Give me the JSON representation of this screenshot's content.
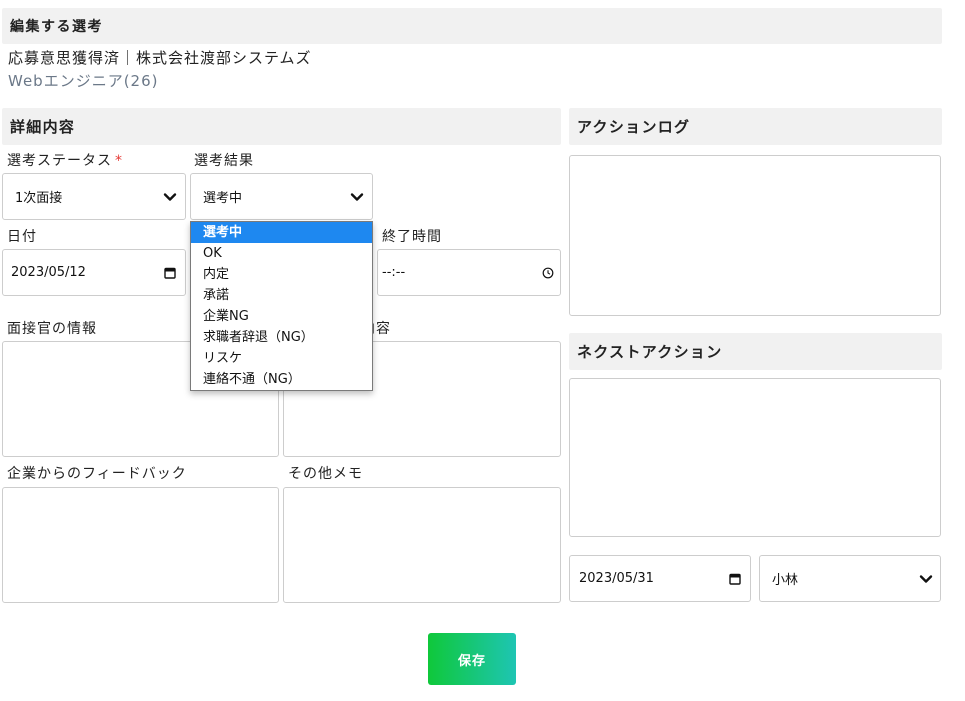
{
  "page": {
    "title": "編集する選考"
  },
  "candidate": {
    "summary": "応募意思獲得済｜株式会社渡部システムズ",
    "position": "Webエンジニア(26)"
  },
  "details": {
    "section_title": "詳細内容",
    "selection_status": {
      "label": "選考ステータス",
      "required_mark": "*",
      "value": "1次面接"
    },
    "selection_result": {
      "label": "選考結果",
      "value": "選考中",
      "dropdown_open": true,
      "highlighted_index": 0,
      "options": [
        "選考中",
        "OK",
        "内定",
        "承諾",
        "企業NG",
        "求職者辞退（NG）",
        "リスケ",
        "連絡不通（NG）"
      ]
    },
    "date": {
      "label": "日付",
      "value": "2023/05/12"
    },
    "end_time": {
      "label": "終了時間",
      "value": "--:--"
    },
    "interviewer_info": {
      "label": "面接官の情報"
    },
    "middle_notes": {
      "label_visible_part": "内容"
    },
    "company_feedback": {
      "label": "企業からのフィードバック"
    },
    "other_memo": {
      "label": "その他メモ"
    }
  },
  "action_log": {
    "section_title": "アクションログ"
  },
  "next_action": {
    "section_title": "ネクストアクション",
    "date": "2023/05/31",
    "assignee": "小林"
  },
  "save_button": {
    "label": "保存"
  },
  "colors": {
    "header_bg": "#f1f1f1",
    "required_mark": "#e53935",
    "position_text": "#6b7888",
    "option_highlight": "#1e88f0",
    "save_gradient_start": "#0fc83a",
    "save_gradient_end": "#1ec5b3"
  },
  "icons": {
    "select": "chevron-down-icon",
    "date_picker": "calendar-icon",
    "time_picker": "clock-icon"
  }
}
